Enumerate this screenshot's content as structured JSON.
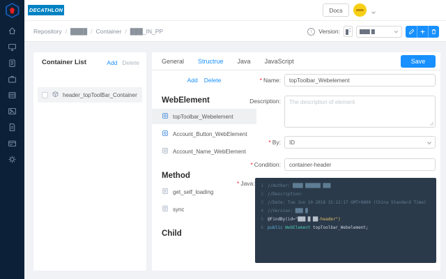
{
  "colors": {
    "accent": "#1890ff",
    "decathlon_blue": "#0082C3",
    "sidebar_bg": "#0c2137",
    "code_bg": "#2b3a4a",
    "avatar_yellow": "#f6cf16"
  },
  "topbar": {
    "brand": "DECATHLON",
    "docs_label": "Docs"
  },
  "breadcrumb": {
    "separator": "/",
    "items": [
      "Repository",
      "████",
      "Container",
      "███_IN_PP"
    ]
  },
  "version_bar": {
    "label": "Version:",
    "selected": "███ █",
    "info_glyph": "i"
  },
  "sidebar_icons": [
    "home",
    "monitor",
    "clipboard",
    "briefcase",
    "server",
    "image",
    "document",
    "card",
    "gear"
  ],
  "container_panel": {
    "title": "Container List",
    "add_label": "Add",
    "delete_label": "Delete",
    "items": [
      {
        "label": "header_topToolBar_Container",
        "checked": false,
        "selected": true
      }
    ]
  },
  "editor": {
    "tabs": [
      {
        "label": "General",
        "active": false
      },
      {
        "label": "Structrue",
        "active": true
      },
      {
        "label": "Java",
        "active": false
      },
      {
        "label": "JavaScript",
        "active": false
      }
    ],
    "save_label": "Save",
    "add_label": "Add",
    "delete_label": "Delete",
    "sections": [
      {
        "title": "WebElement",
        "items": [
          {
            "label": "topToolbar_Webelement",
            "selected": true,
            "blue_icon": true
          },
          {
            "label": "Account_Button_WebElement",
            "selected": false,
            "blue_icon": true
          },
          {
            "label": "Account_Name_WebElement",
            "selected": false,
            "blue_icon": false
          }
        ]
      },
      {
        "title": "Method",
        "items": [
          {
            "label": "get_self_loading",
            "selected": false,
            "blue_icon": false
          },
          {
            "label": "sync",
            "selected": false,
            "blue_icon": false
          }
        ]
      },
      {
        "title": "Child",
        "items": []
      }
    ],
    "form": {
      "required_marker": "*",
      "fields": [
        {
          "name": "name",
          "label": "Name:",
          "required": true,
          "type": "input",
          "value": "topToolbar_Webelement"
        },
        {
          "name": "description",
          "label": "Description:",
          "required": false,
          "type": "textarea",
          "placeholder": "The description of element"
        },
        {
          "name": "by",
          "label": "By:",
          "required": true,
          "type": "select",
          "value": "ID"
        },
        {
          "name": "condition",
          "label": "Condition:",
          "required": true,
          "type": "input",
          "value": "container-header"
        },
        {
          "name": "java",
          "label": "Java:",
          "required": true,
          "type": "code"
        }
      ]
    },
    "code_lines": [
      {
        "num": "1",
        "segs": [
          {
            "t": "//Author: ████ ██████ ███",
            "c": "comment"
          }
        ]
      },
      {
        "num": "2",
        "segs": [
          {
            "t": "//Description:",
            "c": "comment"
          }
        ]
      },
      {
        "num": "3",
        "segs": [
          {
            "t": "//Date: Tue Jun 10 2018 15:12:17 GMT+0800 (China Standard Time)",
            "c": "comment"
          }
        ]
      },
      {
        "num": "4",
        "segs": [
          {
            "t": "//Version: ███ █",
            "c": "comment"
          }
        ]
      },
      {
        "num": "5",
        "segs": [
          {
            "t": "@FindBy(id=\"",
            "c": "plain"
          },
          {
            "t": "███ █ ██",
            "c": "redact"
          },
          {
            "t": "-header\")",
            "c": "string"
          }
        ]
      },
      {
        "num": "6",
        "segs": [
          {
            "t": "public ",
            "c": "kw"
          },
          {
            "t": "WebElement ",
            "c": "type"
          },
          {
            "t": "topToolbar_Webelement;",
            "c": "plain"
          }
        ]
      }
    ]
  }
}
